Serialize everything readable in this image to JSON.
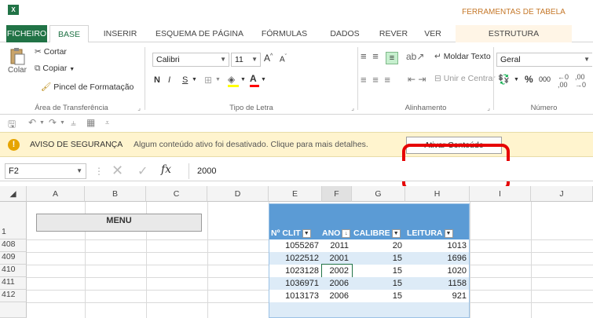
{
  "app": {
    "logo": "X",
    "context_title": "FERRAMENTAS DE TABELA"
  },
  "tabs": [
    {
      "label": "FICHEIRO"
    },
    {
      "label": "BASE"
    },
    {
      "label": "INSERIR"
    },
    {
      "label": "ESQUEMA DE PÁGINA"
    },
    {
      "label": "FÓRMULAS"
    },
    {
      "label": "DADOS"
    },
    {
      "label": "REVER"
    },
    {
      "label": "VER"
    },
    {
      "label": "ESTRUTURA"
    }
  ],
  "ribbon": {
    "clipboard": {
      "paste": "Colar",
      "cut": "Cortar",
      "copy": "Copiar",
      "format_painter": "Pincel de Formatação",
      "label": "Área de Transferência"
    },
    "font": {
      "name": "Calibri",
      "size": "11",
      "bold": "N",
      "italic": "I",
      "underline": "S",
      "label": "Tipo de Letra"
    },
    "alignment": {
      "wrap": "Moldar Texto",
      "merge": "Unir e Centrar",
      "label": "Alinhamento"
    },
    "number": {
      "format": "Geral",
      "percent": "%",
      "thousands": "000",
      "label": "Número"
    }
  },
  "colors": {
    "excel_green": "#217346",
    "table_header": "#5b9bd5",
    "band": "#ddebf7",
    "warning_bar": "#fff4ce",
    "highlight": "#e60000"
  },
  "security": {
    "title": "AVISO DE SEGURANÇA",
    "message": "Algum conteúdo ativo foi desativado. Clique para mais detalhes.",
    "button": "Ativar Conteúdo"
  },
  "formula_bar": {
    "cell": "F2",
    "fx": "fx",
    "value": "2000"
  },
  "grid": {
    "columns": [
      "A",
      "B",
      "C",
      "D",
      "E",
      "F",
      "G",
      "H",
      "I",
      "J"
    ],
    "menu_button": "MENU",
    "table_headers": [
      "Nº CLIT",
      "ANO",
      "CALIBRE",
      "LEITURA"
    ],
    "rows": [
      {
        "num": "1"
      },
      {
        "num": "408",
        "cells": [
          "1055267",
          "2011",
          "20",
          "1013"
        ]
      },
      {
        "num": "409",
        "cells": [
          "1022512",
          "2001",
          "15",
          "1696"
        ]
      },
      {
        "num": "410",
        "cells": [
          "1023128",
          "2002",
          "15",
          "1020"
        ]
      },
      {
        "num": "411",
        "cells": [
          "1036971",
          "2006",
          "15",
          "1158"
        ]
      },
      {
        "num": "412",
        "cells": [
          "1013173",
          "2006",
          "15",
          "921"
        ]
      }
    ]
  }
}
